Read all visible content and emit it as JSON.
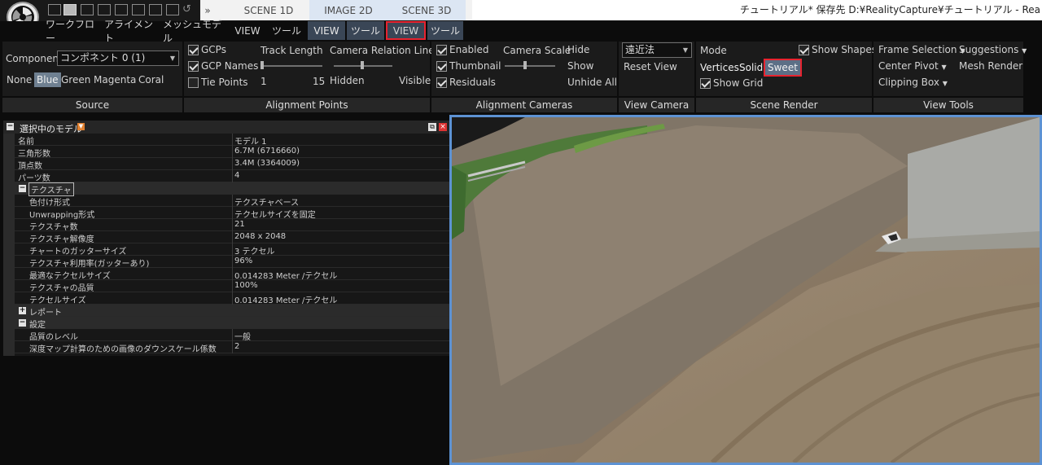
{
  "topbar": {
    "tabs": [
      {
        "label": "SCENE 1D"
      },
      {
        "label": "IMAGE 2D"
      },
      {
        "label": "SCENE 3D"
      }
    ],
    "more_glyph": "»",
    "window_title": "チュートリアル* 保存先 D:¥RealityCapture¥チュートリアル - Rea"
  },
  "menu": {
    "items": [
      "ワークフロー",
      "アライメント",
      "メッシュモデル",
      "VIEW",
      "ツール",
      "VIEW",
      "ツール",
      "VIEW",
      "ツール"
    ]
  },
  "ribbon": {
    "source": {
      "component_label": "Component",
      "component_value": "コンポネント 0 (1)",
      "colors": [
        "None",
        "Blue",
        "Green",
        "Magenta",
        "Coral"
      ],
      "selected_color": "Blue",
      "footer": "Source"
    },
    "alignment_points": {
      "gcps": "GCPs",
      "gcp_names": "GCP Names",
      "tie_points": "Tie Points",
      "track_length": "Track Length",
      "track_min": "1",
      "track_max": "15",
      "camera_relation_lines": "Camera Relation Lines",
      "hidden": "Hidden",
      "visible": "Visible",
      "footer": "Alignment Points"
    },
    "alignment_cameras": {
      "enabled": "Enabled",
      "thumbnail": "Thumbnail",
      "residuals": "Residuals",
      "camera_scale": "Camera Scale",
      "hide": "Hide",
      "show": "Show",
      "unhide_all": "Unhide All",
      "footer": "Alignment Cameras"
    },
    "view_camera": {
      "projection": "遠近法",
      "reset_view": "Reset View",
      "footer": "View Camera"
    },
    "scene_render": {
      "mode": "Mode",
      "vertices": "Vertices",
      "solid": "Solid",
      "sweet": "Sweet",
      "show_shapes": "Show Shapes",
      "show_grid": "Show Grid",
      "footer": "Scene Render"
    },
    "view_tools": {
      "frame_selection": "Frame Selection",
      "suggestions": "Suggestions",
      "center_pivot": "Center Pivot",
      "mesh_render": "Mesh Render",
      "clipping_box": "Clipping Box",
      "footer": "View Tools"
    }
  },
  "properties": {
    "title": "選択中のモデル",
    "rows": [
      {
        "key": "名前",
        "value": "モデル 1"
      },
      {
        "key": "三角形数",
        "value": "6.7M (6716660)"
      },
      {
        "key": "頂点数",
        "value": "3.4M (3364009)"
      },
      {
        "key": "パーツ数",
        "value": "4"
      }
    ],
    "texture_section": "テクスチャ",
    "texture_rows": [
      {
        "key": "色付け形式",
        "value": "テクスチャベース"
      },
      {
        "key": "Unwrapping形式",
        "value": "テクセルサイズを固定"
      },
      {
        "key": "テクスチャ数",
        "value": "21"
      },
      {
        "key": "テクスチャ解像度",
        "value": "2048 x 2048"
      },
      {
        "key": "チャートのガッターサイズ",
        "value": "3 テクセル"
      },
      {
        "key": "テクスチャ利用率(ガッターあり)",
        "value": "96%"
      },
      {
        "key": "最適なテクセルサイズ",
        "value": "0.014283 Meter /テクセル"
      },
      {
        "key": "テクスチャの品質",
        "value": "100%"
      },
      {
        "key": "テクセルサイズ",
        "value": "0.014283 Meter /テクセル"
      }
    ],
    "report_section": "レポート",
    "settings_section": "設定",
    "settings_rows": [
      {
        "key": "品質のレベル",
        "value": "一般"
      },
      {
        "key": "深度マップ計算のための画像のダウンスケール係数",
        "value": "2"
      }
    ]
  },
  "colors": {
    "accent_blue": "#5d92d3",
    "highlight_red": "#e8232f"
  }
}
